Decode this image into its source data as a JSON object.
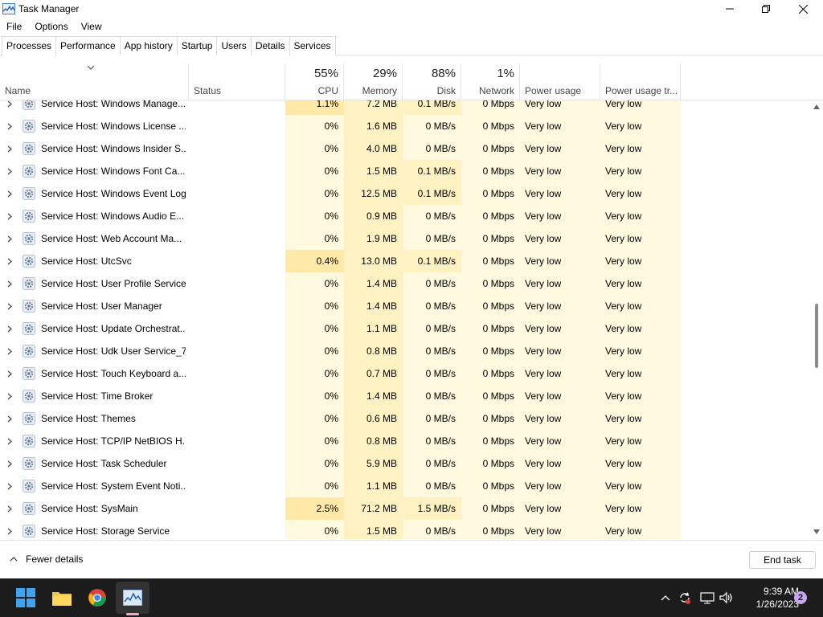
{
  "window": {
    "title": "Task Manager"
  },
  "menu": [
    "File",
    "Options",
    "View"
  ],
  "tabs": [
    {
      "label": "Processes",
      "active": true
    },
    {
      "label": "Performance",
      "active": false
    },
    {
      "label": "App history",
      "active": false
    },
    {
      "label": "Startup",
      "active": false
    },
    {
      "label": "Users",
      "active": false
    },
    {
      "label": "Details",
      "active": false
    },
    {
      "label": "Services",
      "active": false
    }
  ],
  "columns": {
    "name": "Name",
    "status": "Status",
    "cpu": {
      "pct": "55%",
      "label": "CPU"
    },
    "memory": {
      "pct": "29%",
      "label": "Memory"
    },
    "disk": {
      "pct": "88%",
      "label": "Disk"
    },
    "network": {
      "pct": "1%",
      "label": "Network"
    },
    "power": "Power usage",
    "power_trend": "Power usage tr..."
  },
  "rows": [
    {
      "name": "Service Host: Windows Manage...",
      "cpu": "1.1%",
      "memory": "7.2 MB",
      "disk": "0.1 MB/s",
      "network": "0 Mbps",
      "power": "Very low",
      "trend": "Very low"
    },
    {
      "name": "Service Host: Windows License ...",
      "cpu": "0%",
      "memory": "1.6 MB",
      "disk": "0 MB/s",
      "network": "0 Mbps",
      "power": "Very low",
      "trend": "Very low"
    },
    {
      "name": "Service Host: Windows Insider S...",
      "cpu": "0%",
      "memory": "4.0 MB",
      "disk": "0 MB/s",
      "network": "0 Mbps",
      "power": "Very low",
      "trend": "Very low"
    },
    {
      "name": "Service Host: Windows Font Ca...",
      "cpu": "0%",
      "memory": "1.5 MB",
      "disk": "0.1 MB/s",
      "network": "0 Mbps",
      "power": "Very low",
      "trend": "Very low"
    },
    {
      "name": "Service Host: Windows Event Log",
      "cpu": "0%",
      "memory": "12.5 MB",
      "disk": "0.1 MB/s",
      "network": "0 Mbps",
      "power": "Very low",
      "trend": "Very low"
    },
    {
      "name": "Service Host: Windows Audio E...",
      "cpu": "0%",
      "memory": "0.9 MB",
      "disk": "0 MB/s",
      "network": "0 Mbps",
      "power": "Very low",
      "trend": "Very low"
    },
    {
      "name": "Service Host: Web Account Ma...",
      "cpu": "0%",
      "memory": "1.9 MB",
      "disk": "0 MB/s",
      "network": "0 Mbps",
      "power": "Very low",
      "trend": "Very low"
    },
    {
      "name": "Service Host: UtcSvc",
      "cpu": "0.4%",
      "memory": "13.0 MB",
      "disk": "0.1 MB/s",
      "network": "0 Mbps",
      "power": "Very low",
      "trend": "Very low"
    },
    {
      "name": "Service Host: User Profile Service",
      "cpu": "0%",
      "memory": "1.4 MB",
      "disk": "0 MB/s",
      "network": "0 Mbps",
      "power": "Very low",
      "trend": "Very low"
    },
    {
      "name": "Service Host: User Manager",
      "cpu": "0%",
      "memory": "1.4 MB",
      "disk": "0 MB/s",
      "network": "0 Mbps",
      "power": "Very low",
      "trend": "Very low"
    },
    {
      "name": "Service Host: Update Orchestrat...",
      "cpu": "0%",
      "memory": "1.1 MB",
      "disk": "0 MB/s",
      "network": "0 Mbps",
      "power": "Very low",
      "trend": "Very low"
    },
    {
      "name": "Service Host: Udk User Service_7...",
      "cpu": "0%",
      "memory": "0.8 MB",
      "disk": "0 MB/s",
      "network": "0 Mbps",
      "power": "Very low",
      "trend": "Very low"
    },
    {
      "name": "Service Host: Touch Keyboard a...",
      "cpu": "0%",
      "memory": "0.7 MB",
      "disk": "0 MB/s",
      "network": "0 Mbps",
      "power": "Very low",
      "trend": "Very low"
    },
    {
      "name": "Service Host: Time Broker",
      "cpu": "0%",
      "memory": "1.4 MB",
      "disk": "0 MB/s",
      "network": "0 Mbps",
      "power": "Very low",
      "trend": "Very low"
    },
    {
      "name": "Service Host: Themes",
      "cpu": "0%",
      "memory": "0.6 MB",
      "disk": "0 MB/s",
      "network": "0 Mbps",
      "power": "Very low",
      "trend": "Very low"
    },
    {
      "name": "Service Host: TCP/IP NetBIOS H...",
      "cpu": "0%",
      "memory": "0.8 MB",
      "disk": "0 MB/s",
      "network": "0 Mbps",
      "power": "Very low",
      "trend": "Very low"
    },
    {
      "name": "Service Host: Task Scheduler",
      "cpu": "0%",
      "memory": "5.9 MB",
      "disk": "0 MB/s",
      "network": "0 Mbps",
      "power": "Very low",
      "trend": "Very low"
    },
    {
      "name": "Service Host: System Event Noti...",
      "cpu": "0%",
      "memory": "1.1 MB",
      "disk": "0 MB/s",
      "network": "0 Mbps",
      "power": "Very low",
      "trend": "Very low"
    },
    {
      "name": "Service Host: SysMain",
      "cpu": "2.5%",
      "memory": "71.2 MB",
      "disk": "1.5 MB/s",
      "network": "0 Mbps",
      "power": "Very low",
      "trend": "Very low"
    },
    {
      "name": "Service Host: Storage Service",
      "cpu": "0%",
      "memory": "1.5 MB",
      "disk": "0 MB/s",
      "network": "0 Mbps",
      "power": "Very low",
      "trend": "Very low"
    }
  ],
  "bottom": {
    "fewer_details": "Fewer details",
    "end_task": "End task"
  },
  "taskbar": {
    "apps": [
      "start-icon",
      "file-explorer-icon",
      "chrome-icon",
      "task-manager-icon"
    ],
    "clock_time": "9:39 AM",
    "clock_date": "1/26/2023",
    "notification_count": "2"
  },
  "colors": {
    "heat_light": "#fff9e0",
    "heat_medium": "#fff2c2",
    "heat_strong": "#ffe9a8",
    "taskbar_bg": "#1c1c1c"
  }
}
